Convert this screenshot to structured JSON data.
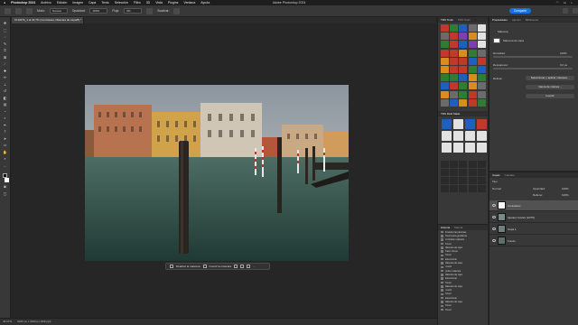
{
  "menubar": {
    "app": "Photoshop 2024",
    "items": [
      "Archivo",
      "Edición",
      "Imagen",
      "Capa",
      "Texto",
      "Selección",
      "Filtro",
      "3D",
      "Vista",
      "Plugins",
      "Ventana",
      "Ayuda"
    ],
    "window_title": "Adobe Photoshop 2024"
  },
  "optbar": {
    "mode_label": "Modo:",
    "mode_value": "Normal",
    "opacity_label": "Opacidad:",
    "opacity_value": "100%",
    "flow_label": "Flujo:",
    "flow_value": "9%",
    "smooth_label": "Suavizar:",
    "share_label": "Compartir"
  },
  "doc_tab": {
    "label": "971037b_1 al 33,7% (Contrastes, Máscara de capa/8) *"
  },
  "context_bar": {
    "mask_label": "Realizar la máscara",
    "invert_label": "Invertir la máscara"
  },
  "status": {
    "zoom": "33,67%",
    "info": "6240 px x 4160 px (300 ppi)"
  },
  "glyphs": {
    "tab_active": "TRS Tools",
    "tab_2": "TRS Tools",
    "tab_bottom": "TRS Multi Mask",
    "colors": [
      "#c0392b",
      "#2f7d32",
      "#1f5fbf",
      "#6b6b6b",
      "#e2e2e2",
      "#6b6b6b",
      "#c0392b",
      "#7a3fb0",
      "#d98c1f",
      "#e2e2e2",
      "#2f7d32",
      "#c0392b",
      "#1f5fbf",
      "#7a3fb0",
      "#e2e2e2",
      "#c0392b",
      "#c0392b",
      "#d98c1f",
      "#2f7d32",
      "#6b6b6b",
      "#d98c1f",
      "#c0392b",
      "#c0392b",
      "#1f5fbf",
      "#c0392b",
      "#d98c1f",
      "#c0392b",
      "#c0392b",
      "#2f7d32",
      "#1f5fbf",
      "#2f7d32",
      "#2f7d32",
      "#1f5fbf",
      "#d98c1f",
      "#2f7d32",
      "#1f5fbf",
      "#c0392b",
      "#2f7d32",
      "#d98c1f",
      "#6b6b6b",
      "#d98c1f",
      "#6b6b6b",
      "#2f7d32",
      "#c0392b",
      "#6b6b6b",
      "#6b6b6b",
      "#1f5fbf",
      "#d98c1f",
      "#c0392b",
      "#2f7d32"
    ],
    "mask_colors": [
      "#1f5fbf",
      "#e2e2e2",
      "#1f5fbf",
      "#c0392b",
      "#e2e2e2",
      "#e2e2e2",
      "#e2e2e2",
      "#e2e2e2",
      "#e2e2e2",
      "#e2e2e2",
      "#e2e2e2",
      "#e2e2e2"
    ],
    "bottom_colors": [
      "#2a2a2a",
      "#2a2a2a",
      "#2a2a2a",
      "#2a2a2a",
      "#2a2a2a",
      "#2a2a2a",
      "#2a2a2a",
      "#2a2a2a",
      "#2a2a2a",
      "#2a2a2a",
      "#2a2a2a",
      "#2a2a2a",
      "#2a2a2a",
      "#2a2a2a",
      "#2a2a2a",
      "#2a2a2a",
      "#2a2a2a",
      "#2a2a2a",
      "#2a2a2a",
      "#2a2a2a"
    ]
  },
  "properties": {
    "tabs": [
      "Propiedades",
      "Ajustes",
      "Bibliotecas"
    ],
    "section": "Máscara",
    "layer_mask_label": "Máscara de capa",
    "density_label": "Densidad:",
    "density_value": "100%",
    "feather_label": "Desvanecer:",
    "feather_value": "0,0 px",
    "refine_label": "Refinar:",
    "btn_select": "Seleccionar y aplicar máscara...",
    "btn_color": "Gama de colores...",
    "btn_invert": "Invertir"
  },
  "layers": {
    "tabs": [
      "Capas",
      "Canales"
    ],
    "kind_label": "Tipo",
    "blend_mode": "Normal",
    "opacity_label": "Opacidad:",
    "opacity_value": "100%",
    "fill_label": "Relleno:",
    "fill_value": "100%",
    "rows": [
      {
        "name": "Contrastes",
        "thumb": "#ffffff",
        "selected": true
      },
      {
        "name": "Ajustes niveles (LR76)",
        "thumb": "#7a8a88",
        "selected": false
      },
      {
        "name": "Capa 1",
        "thumb": "#6e7f7c",
        "selected": false
      },
      {
        "name": "Fondo",
        "thumb": "#5e6f6c",
        "selected": false
      }
    ]
  },
  "history": {
    "tabs": [
      "Historia",
      "Marcar"
    ],
    "items": [
      "Arrastrar las láminas",
      "Pincel para gradiente",
      "Contraste máscara",
      "Pincel",
      "Máscara de capa",
      "Trazo Grupo",
      "Pincel",
      "Seleccionar",
      "Máscara de capa",
      "Invertir",
      "Quitar máscara",
      "Máscara de capa",
      "Seleccionar",
      "Pincel",
      "Máscara de capa",
      "Invertir",
      "Pincel",
      "Seleccionar",
      "Máscara de capa",
      "Pincel",
      "Pincel"
    ]
  }
}
